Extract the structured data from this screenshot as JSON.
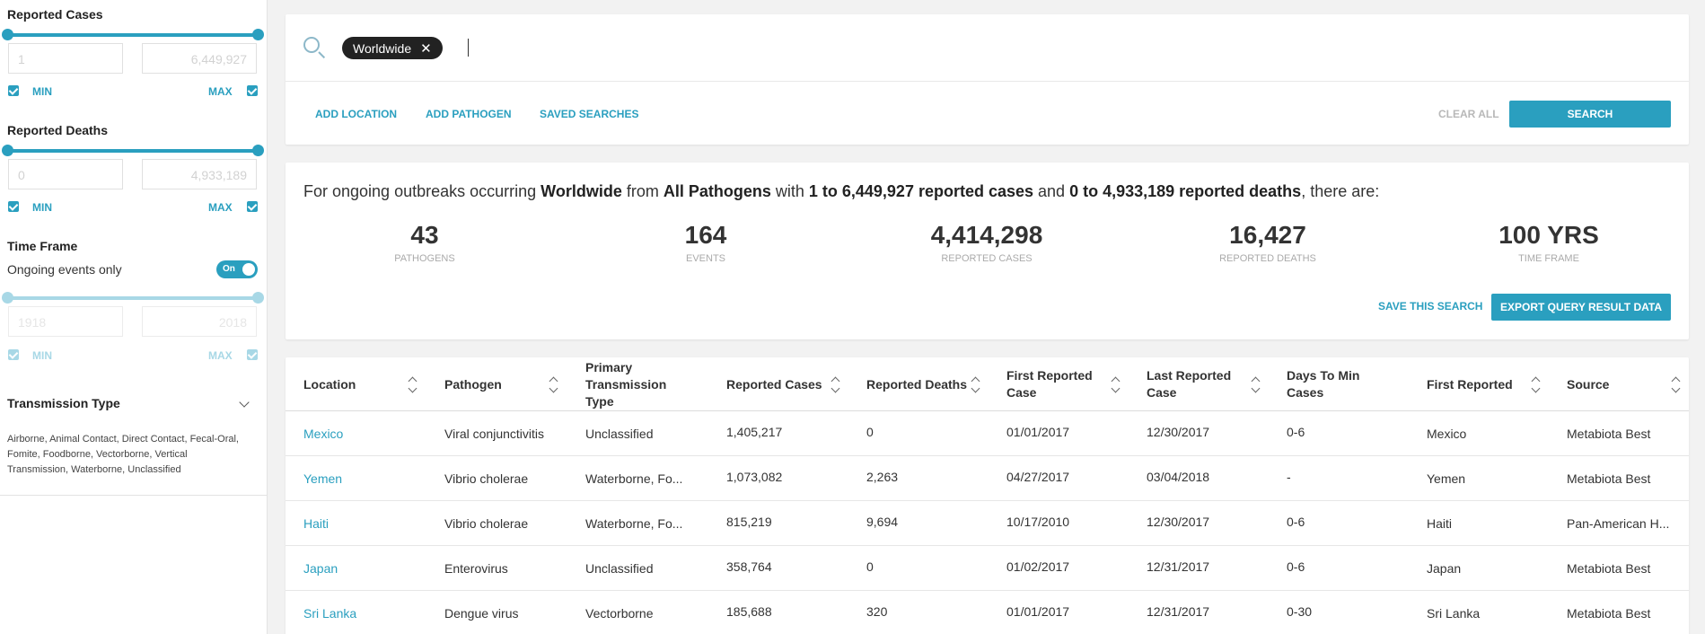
{
  "filters": {
    "reported_cases": {
      "title": "Reported Cases",
      "min_value": "1",
      "max_value": "6,449,927",
      "min_label": "MIN",
      "max_label": "MAX"
    },
    "reported_deaths": {
      "title": "Reported Deaths",
      "min_value": "0",
      "max_value": "4,933,189",
      "min_label": "MIN",
      "max_label": "MAX"
    },
    "time_frame": {
      "title": "Time Frame",
      "ongoing_label": "Ongoing events only",
      "toggle_label": "On",
      "min_value": "1918",
      "max_value": "2018",
      "min_label": "MIN",
      "max_label": "MAX"
    },
    "transmission": {
      "title": "Transmission Type",
      "list": "Airborne, Animal Contact, Direct Contact, Fecal-Oral, Fomite, Foodborne, Vectorborne, Vertical Transmission, Waterborne, Unclassified"
    }
  },
  "search": {
    "chip": "Worldwide",
    "add_location": "ADD LOCATION",
    "add_pathogen": "ADD PATHOGEN",
    "saved_searches": "SAVED SEARCHES",
    "clear_all": "CLEAR ALL",
    "search_button": "SEARCH"
  },
  "summary": {
    "s1": "For ongoing outbreaks occurring ",
    "b1": "Worldwide",
    "s2": " from ",
    "b2": "All Pathogens",
    "s3": " with ",
    "b3": "1 to 6,449,927 reported cases",
    "s4": " and ",
    "b4": "0 to 4,933,189 reported deaths",
    "s5": ", there are:",
    "stats": [
      {
        "value": "43",
        "label": "PATHOGENS"
      },
      {
        "value": "164",
        "label": "EVENTS"
      },
      {
        "value": "4,414,298",
        "label": "REPORTED CASES"
      },
      {
        "value": "16,427",
        "label": "REPORTED DEATHS"
      },
      {
        "value": "100 YRS",
        "label": "TIME FRAME"
      }
    ],
    "save_search": "SAVE THIS SEARCH",
    "export": "EXPORT QUERY RESULT DATA"
  },
  "table": {
    "columns": [
      "Location",
      "Pathogen",
      "Primary Transmission Type",
      "Reported Cases",
      "Reported Deaths",
      "First Reported Case",
      "Last Reported Case",
      "Days To Min Cases",
      "First Reported",
      "Source"
    ],
    "rows": [
      [
        "Mexico",
        "Viral conjunctivitis",
        "Unclassified",
        "1,405,217",
        "0",
        "01/01/2017",
        "12/30/2017",
        "0-6",
        "Mexico",
        "Metabiota Best"
      ],
      [
        "Yemen",
        "Vibrio cholerae",
        "Waterborne, Fo...",
        "1,073,082",
        "2,263",
        "04/27/2017",
        "03/04/2018",
        "-",
        "Yemen",
        "Metabiota Best"
      ],
      [
        "Haiti",
        "Vibrio cholerae",
        "Waterborne, Fo...",
        "815,219",
        "9,694",
        "10/17/2010",
        "12/30/2017",
        "0-6",
        "Haiti",
        "Pan-American H..."
      ],
      [
        "Japan",
        "Enterovirus",
        "Unclassified",
        "358,764",
        "0",
        "01/02/2017",
        "12/31/2017",
        "0-6",
        "Japan",
        "Metabiota Best"
      ],
      [
        "Sri Lanka",
        "Dengue virus",
        "Vectorborne",
        "185,688",
        "320",
        "01/01/2017",
        "12/31/2017",
        "0-30",
        "Sri Lanka",
        "Metabiota Best"
      ]
    ]
  },
  "colors": {
    "accent": "#2a9fbf",
    "accent_faded": "#a8d8e6",
    "background": "#f2f2f2"
  }
}
